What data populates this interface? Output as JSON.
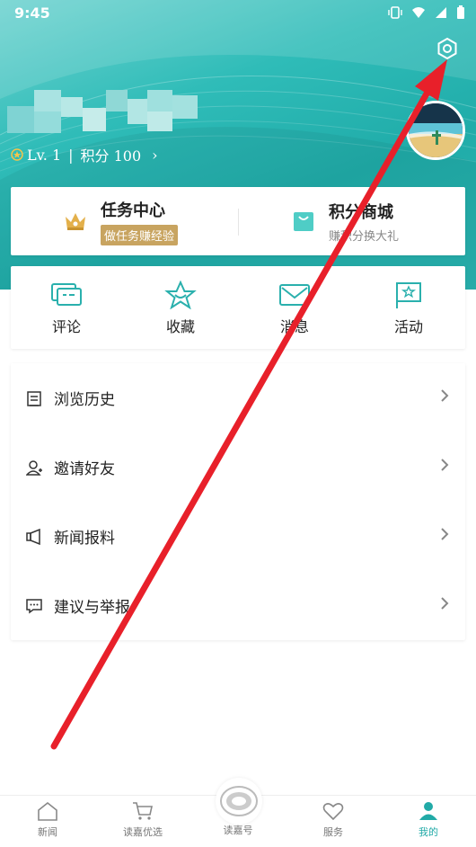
{
  "status_bar": {
    "time": "9:45"
  },
  "profile": {
    "level": "Lv. 1",
    "points_label": "积分 100",
    "chevron": "›"
  },
  "task_card": {
    "task_center": {
      "title": "任务中心",
      "subtitle": "做任务赚经验"
    },
    "points_mall": {
      "title": "积分商城",
      "subtitle": "赚积分换大礼"
    }
  },
  "quick_actions": [
    {
      "label": "评论",
      "icon": "comment-icon"
    },
    {
      "label": "收藏",
      "icon": "star-icon"
    },
    {
      "label": "消息",
      "icon": "mail-icon"
    },
    {
      "label": "活动",
      "icon": "flag-icon"
    }
  ],
  "menu": [
    {
      "label": "浏览历史",
      "icon": "history-icon"
    },
    {
      "label": "邀请好友",
      "icon": "invite-user-icon"
    },
    {
      "label": "新闻报料",
      "icon": "news-tip-icon"
    },
    {
      "label": "建议与举报",
      "icon": "feedback-icon"
    }
  ],
  "bottom_nav": [
    {
      "label": "新闻",
      "icon": "home-icon"
    },
    {
      "label": "读嘉优选",
      "icon": "cart-icon"
    },
    {
      "label": "读嘉号",
      "icon": "dujia-logo-icon"
    },
    {
      "label": "服务",
      "icon": "heart-icon"
    },
    {
      "label": "我的",
      "icon": "user-icon"
    }
  ],
  "colors": {
    "header_teal": "#20aca9",
    "accent_gold": "#c8a460",
    "annotation_red": "#e8202a",
    "active_nav": "#21aaa7"
  }
}
